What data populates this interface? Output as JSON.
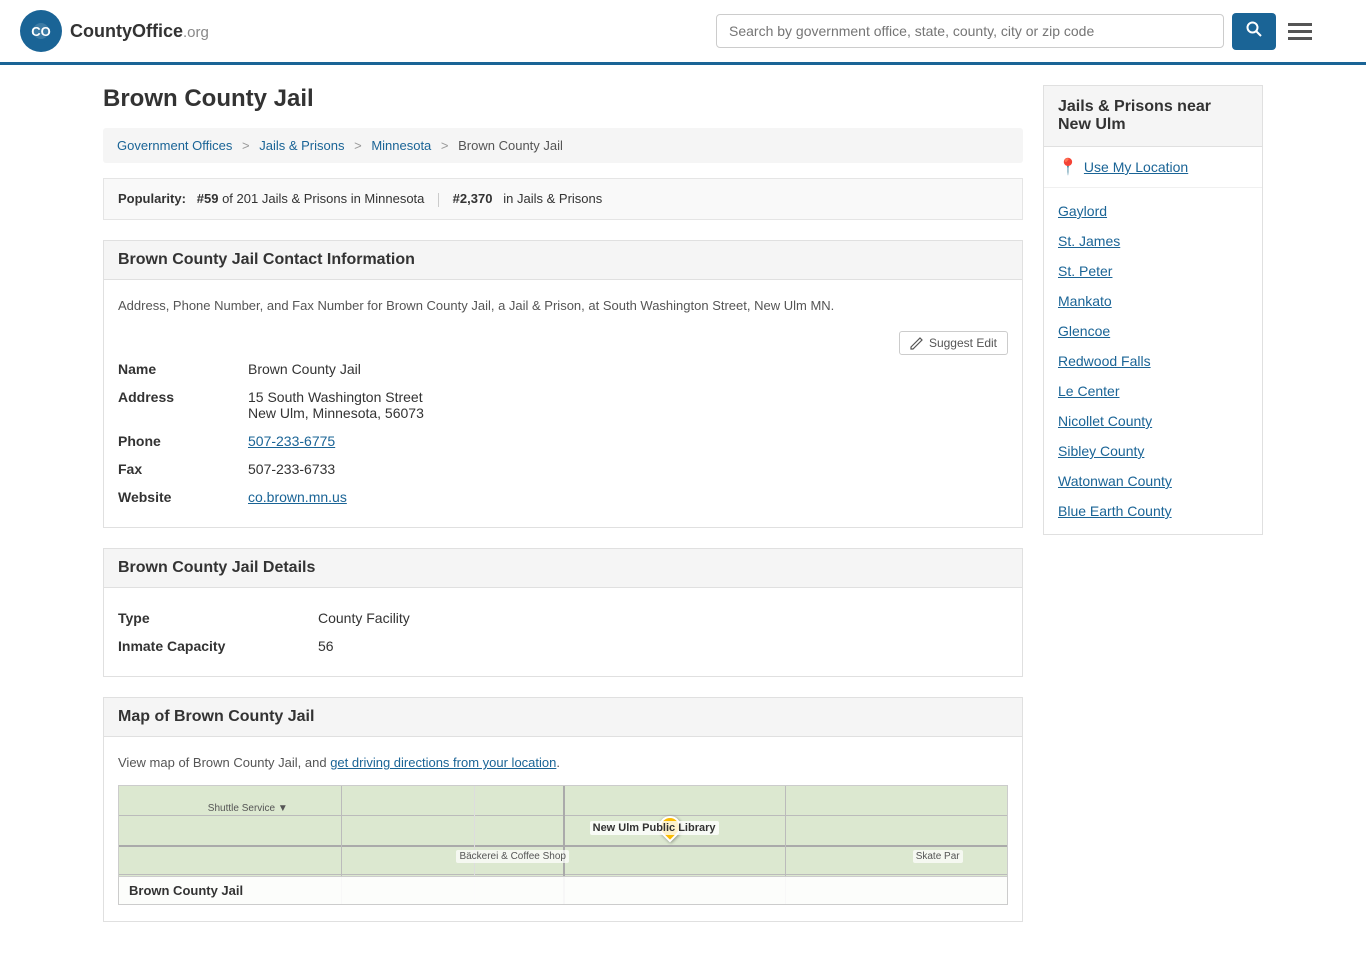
{
  "header": {
    "logo_icon": "🏛",
    "logo_name": "CountyOffice",
    "logo_tld": ".org",
    "search_placeholder": "Search by government office, state, county, city or zip code",
    "search_btn_icon": "🔍",
    "menu_icon": "☰"
  },
  "page": {
    "title": "Brown County Jail"
  },
  "breadcrumb": {
    "items": [
      {
        "label": "Government Offices",
        "href": "#"
      },
      {
        "label": "Jails & Prisons",
        "href": "#"
      },
      {
        "label": "Minnesota",
        "href": "#"
      },
      {
        "label": "Brown County Jail",
        "href": "#"
      }
    ]
  },
  "popularity": {
    "label": "Popularity:",
    "rank1": "#59",
    "rank1_text": "of 201 Jails & Prisons in Minnesota",
    "rank2": "#2,370",
    "rank2_text": "in Jails & Prisons"
  },
  "contact_section": {
    "title": "Brown County Jail Contact Information",
    "description": "Address, Phone Number, and Fax Number for Brown County Jail, a Jail & Prison, at South Washington Street, New Ulm MN.",
    "suggest_edit_label": "Suggest Edit",
    "fields": {
      "name_label": "Name",
      "name_value": "Brown County Jail",
      "address_label": "Address",
      "address_line1": "15 South Washington Street",
      "address_line2": "New Ulm, Minnesota, 56073",
      "phone_label": "Phone",
      "phone_value": "507-233-6775",
      "fax_label": "Fax",
      "fax_value": "507-233-6733",
      "website_label": "Website",
      "website_value": "co.brown.mn.us"
    }
  },
  "details_section": {
    "title": "Brown County Jail Details",
    "fields": {
      "type_label": "Type",
      "type_value": "County Facility",
      "capacity_label": "Inmate Capacity",
      "capacity_value": "56"
    }
  },
  "map_section": {
    "title": "Map of Brown County Jail",
    "description_prefix": "View map of Brown County Jail, and ",
    "directions_link": "get driving directions from your location",
    "directions_href": "#",
    "map_label": "Brown County Jail"
  },
  "sidebar": {
    "title": "Jails & Prisons near New Ulm",
    "use_location_label": "Use My Location",
    "links": [
      {
        "label": "Gaylord",
        "href": "#"
      },
      {
        "label": "St. James",
        "href": "#"
      },
      {
        "label": "St. Peter",
        "href": "#"
      },
      {
        "label": "Mankato",
        "href": "#"
      },
      {
        "label": "Glencoe",
        "href": "#"
      },
      {
        "label": "Redwood Falls",
        "href": "#"
      },
      {
        "label": "Le Center",
        "href": "#"
      },
      {
        "label": "Nicollet County",
        "href": "#"
      },
      {
        "label": "Sibley County",
        "href": "#"
      },
      {
        "label": "Watonwan County",
        "href": "#"
      },
      {
        "label": "Blue Earth County",
        "href": "#"
      }
    ]
  }
}
